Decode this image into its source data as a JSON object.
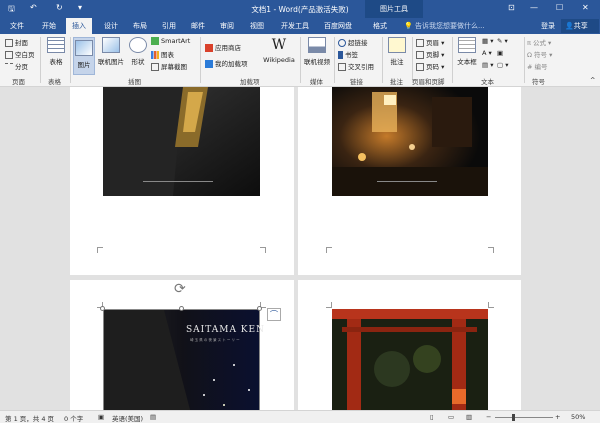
{
  "titlebar": {
    "title": "文档1 - Word(产品激活失败)",
    "context_tool": "图片工具",
    "qat_save": "🖫",
    "qat_undo": "↶",
    "qat_redo": "↻",
    "qat_more": "▾",
    "win_ribbon": "⊡",
    "win_min": "—",
    "win_max": "☐",
    "win_close": "✕"
  },
  "tabs": [
    "文件",
    "开始",
    "插入",
    "设计",
    "布局",
    "引用",
    "邮件",
    "审阅",
    "视图",
    "开发工具",
    "百度网盘",
    "格式"
  ],
  "active_tab_index": 2,
  "tellme": "告诉我您想要做什么...",
  "login": "登录",
  "share": "共享",
  "ribbon": {
    "pages": {
      "cover": "封面",
      "blank": "空白页",
      "break": "分页",
      "label": "页面"
    },
    "tables": {
      "table": "表格",
      "label": "表格"
    },
    "illus": {
      "picture": "图片",
      "online_picture": "联机图片",
      "shapes": "形状",
      "smartart": "SmartArt",
      "chart": "图表",
      "screenshot": "屏幕截图",
      "label": "插图"
    },
    "addins": {
      "store": "应用商店",
      "myaddins": "我的加载项",
      "wikipedia": "Wikipedia",
      "label": "加载项"
    },
    "media": {
      "online_video": "联机视频",
      "label": "媒体"
    },
    "links": {
      "hyperlink": "超链接",
      "bookmark": "书签",
      "crossref": "交叉引用",
      "label": "链接"
    },
    "comments": {
      "comment": "批注",
      "label": "批注"
    },
    "hf": {
      "header": "页眉",
      "footer": "页脚",
      "pagenum": "页码",
      "label": "页眉和页脚"
    },
    "text": {
      "textbox": "文本框",
      "label": "文本"
    },
    "symbols": {
      "equation": "公式",
      "symbol": "符号",
      "number": "编号",
      "label": "符号"
    }
  },
  "document": {
    "cover_title": "SAITAMA KEN",
    "cover_subtitle": "埼 玉 県 の 夜 景 ス ト ー リ ー"
  },
  "status": {
    "page": "第 1 页，共 4 页",
    "words": "0 个字",
    "lang": "英语(美国)",
    "zoom": "50%",
    "minus": "−",
    "plus": "+"
  },
  "colors": {
    "accent": "#2b579a",
    "ribbon_bg": "#f3f3f3"
  }
}
